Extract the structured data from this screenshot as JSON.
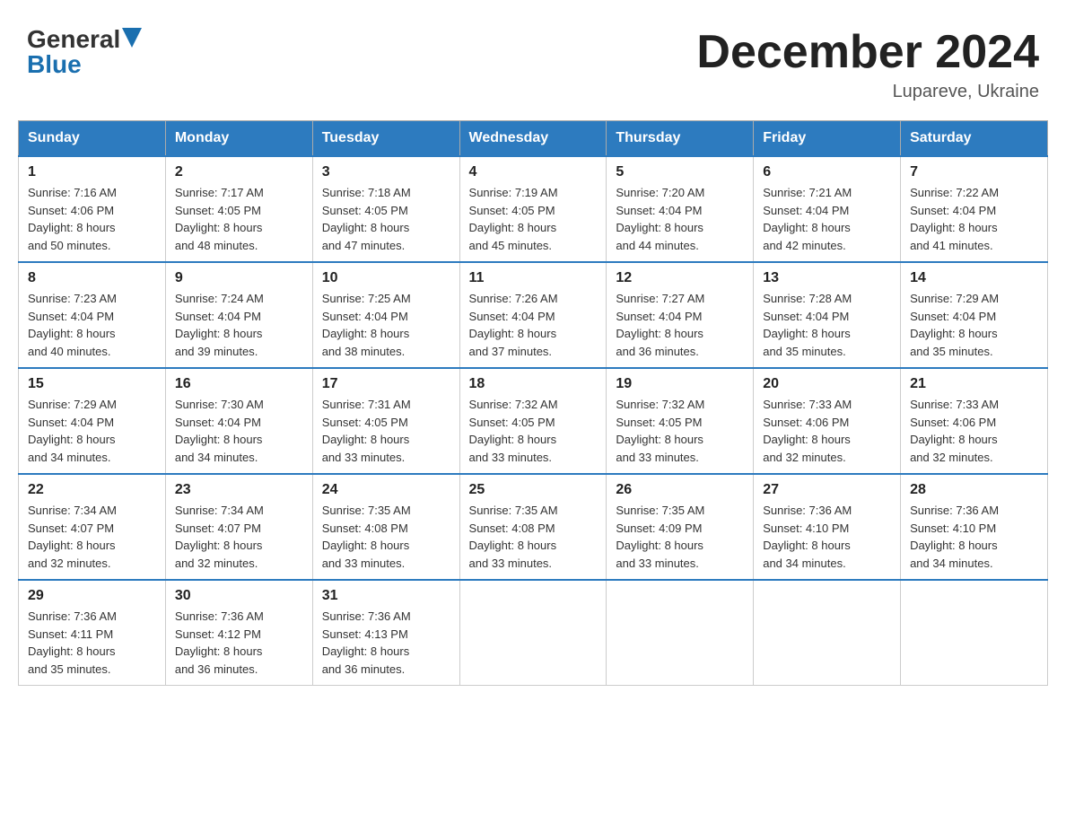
{
  "header": {
    "logo_general": "General",
    "logo_blue": "Blue",
    "month_year": "December 2024",
    "location": "Lupareve, Ukraine"
  },
  "days_of_week": [
    "Sunday",
    "Monday",
    "Tuesday",
    "Wednesday",
    "Thursday",
    "Friday",
    "Saturday"
  ],
  "weeks": [
    [
      {
        "day": "1",
        "sunrise": "7:16 AM",
        "sunset": "4:06 PM",
        "daylight": "8 hours and 50 minutes."
      },
      {
        "day": "2",
        "sunrise": "7:17 AM",
        "sunset": "4:05 PM",
        "daylight": "8 hours and 48 minutes."
      },
      {
        "day": "3",
        "sunrise": "7:18 AM",
        "sunset": "4:05 PM",
        "daylight": "8 hours and 47 minutes."
      },
      {
        "day": "4",
        "sunrise": "7:19 AM",
        "sunset": "4:05 PM",
        "daylight": "8 hours and 45 minutes."
      },
      {
        "day": "5",
        "sunrise": "7:20 AM",
        "sunset": "4:04 PM",
        "daylight": "8 hours and 44 minutes."
      },
      {
        "day": "6",
        "sunrise": "7:21 AM",
        "sunset": "4:04 PM",
        "daylight": "8 hours and 42 minutes."
      },
      {
        "day": "7",
        "sunrise": "7:22 AM",
        "sunset": "4:04 PM",
        "daylight": "8 hours and 41 minutes."
      }
    ],
    [
      {
        "day": "8",
        "sunrise": "7:23 AM",
        "sunset": "4:04 PM",
        "daylight": "8 hours and 40 minutes."
      },
      {
        "day": "9",
        "sunrise": "7:24 AM",
        "sunset": "4:04 PM",
        "daylight": "8 hours and 39 minutes."
      },
      {
        "day": "10",
        "sunrise": "7:25 AM",
        "sunset": "4:04 PM",
        "daylight": "8 hours and 38 minutes."
      },
      {
        "day": "11",
        "sunrise": "7:26 AM",
        "sunset": "4:04 PM",
        "daylight": "8 hours and 37 minutes."
      },
      {
        "day": "12",
        "sunrise": "7:27 AM",
        "sunset": "4:04 PM",
        "daylight": "8 hours and 36 minutes."
      },
      {
        "day": "13",
        "sunrise": "7:28 AM",
        "sunset": "4:04 PM",
        "daylight": "8 hours and 35 minutes."
      },
      {
        "day": "14",
        "sunrise": "7:29 AM",
        "sunset": "4:04 PM",
        "daylight": "8 hours and 35 minutes."
      }
    ],
    [
      {
        "day": "15",
        "sunrise": "7:29 AM",
        "sunset": "4:04 PM",
        "daylight": "8 hours and 34 minutes."
      },
      {
        "day": "16",
        "sunrise": "7:30 AM",
        "sunset": "4:04 PM",
        "daylight": "8 hours and 34 minutes."
      },
      {
        "day": "17",
        "sunrise": "7:31 AM",
        "sunset": "4:05 PM",
        "daylight": "8 hours and 33 minutes."
      },
      {
        "day": "18",
        "sunrise": "7:32 AM",
        "sunset": "4:05 PM",
        "daylight": "8 hours and 33 minutes."
      },
      {
        "day": "19",
        "sunrise": "7:32 AM",
        "sunset": "4:05 PM",
        "daylight": "8 hours and 33 minutes."
      },
      {
        "day": "20",
        "sunrise": "7:33 AM",
        "sunset": "4:06 PM",
        "daylight": "8 hours and 32 minutes."
      },
      {
        "day": "21",
        "sunrise": "7:33 AM",
        "sunset": "4:06 PM",
        "daylight": "8 hours and 32 minutes."
      }
    ],
    [
      {
        "day": "22",
        "sunrise": "7:34 AM",
        "sunset": "4:07 PM",
        "daylight": "8 hours and 32 minutes."
      },
      {
        "day": "23",
        "sunrise": "7:34 AM",
        "sunset": "4:07 PM",
        "daylight": "8 hours and 32 minutes."
      },
      {
        "day": "24",
        "sunrise": "7:35 AM",
        "sunset": "4:08 PM",
        "daylight": "8 hours and 33 minutes."
      },
      {
        "day": "25",
        "sunrise": "7:35 AM",
        "sunset": "4:08 PM",
        "daylight": "8 hours and 33 minutes."
      },
      {
        "day": "26",
        "sunrise": "7:35 AM",
        "sunset": "4:09 PM",
        "daylight": "8 hours and 33 minutes."
      },
      {
        "day": "27",
        "sunrise": "7:36 AM",
        "sunset": "4:10 PM",
        "daylight": "8 hours and 34 minutes."
      },
      {
        "day": "28",
        "sunrise": "7:36 AM",
        "sunset": "4:10 PM",
        "daylight": "8 hours and 34 minutes."
      }
    ],
    [
      {
        "day": "29",
        "sunrise": "7:36 AM",
        "sunset": "4:11 PM",
        "daylight": "8 hours and 35 minutes."
      },
      {
        "day": "30",
        "sunrise": "7:36 AM",
        "sunset": "4:12 PM",
        "daylight": "8 hours and 36 minutes."
      },
      {
        "day": "31",
        "sunrise": "7:36 AM",
        "sunset": "4:13 PM",
        "daylight": "8 hours and 36 minutes."
      },
      null,
      null,
      null,
      null
    ]
  ],
  "labels": {
    "sunrise": "Sunrise:",
    "sunset": "Sunset:",
    "daylight": "Daylight:"
  }
}
